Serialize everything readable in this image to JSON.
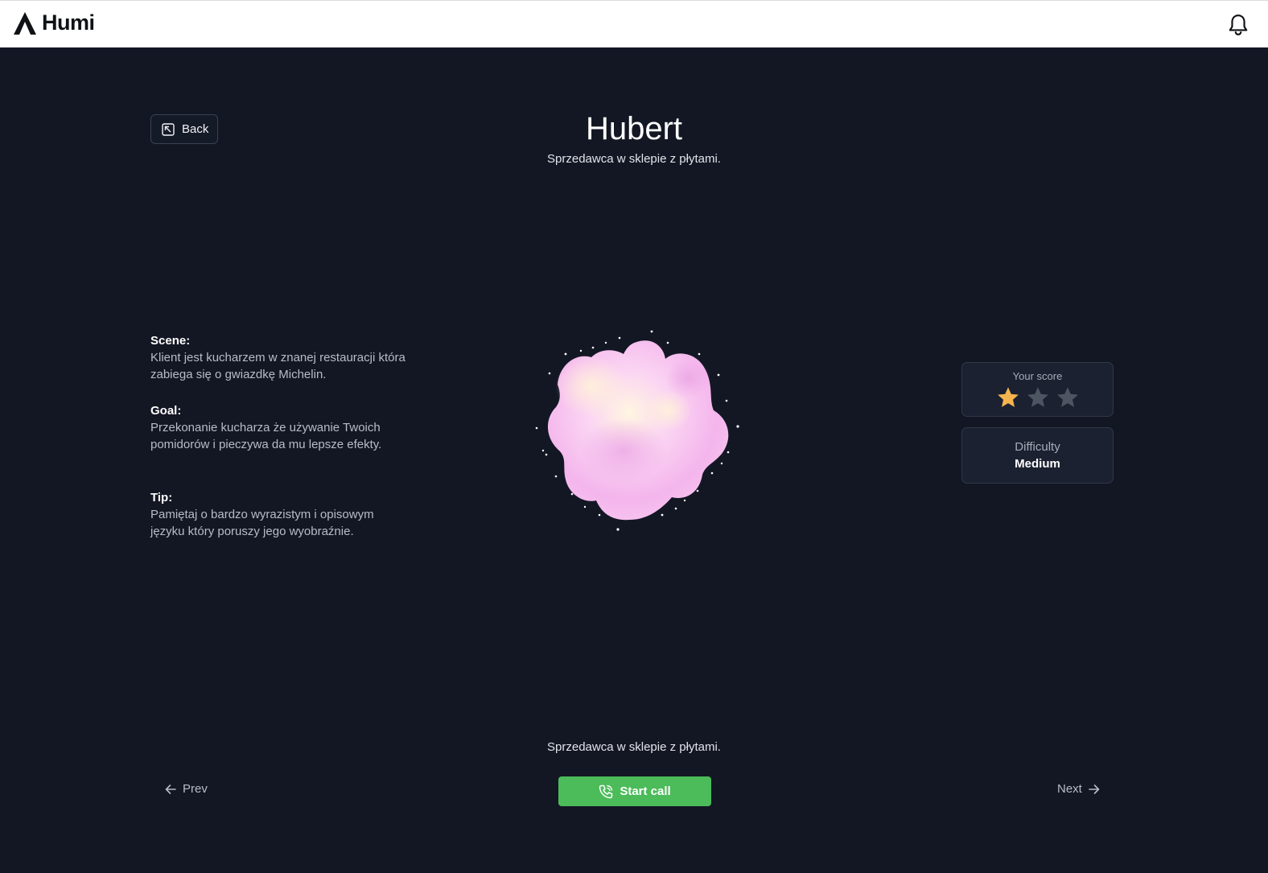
{
  "header": {
    "brand": "Humi",
    "icons": {
      "logo": "triangle-logo-icon",
      "notifications": "bell-icon"
    }
  },
  "persona": {
    "name": "Hubert",
    "role": "Sprzedawca w sklepie z płytami."
  },
  "back_button": {
    "label": "Back",
    "icon": "return-icon"
  },
  "briefing": {
    "scene_label": "Scene:",
    "scene_text": "Klient jest kucharzem w znanej restauracji która zabiega się o gwiazdkę Michelin.",
    "goal_label": "Goal:",
    "goal_text": "Przekonanie kucharza że używanie Twoich pomidorów i pieczywa da mu lepsze efekty.",
    "tip_label": "Tip:",
    "tip_text": "Pamiętaj o bardzo wyrazistym i opisowym języku który poruszy jego wyobraźnie."
  },
  "score": {
    "label": "Your score",
    "stars_filled": 1,
    "stars_total": 3,
    "filled_color": "#f6b44f",
    "empty_color": "#4d5563"
  },
  "difficulty": {
    "label": "Difficulty",
    "value": "Medium"
  },
  "footer": {
    "caption": "Sprzedawca w sklepie z płytami.",
    "start_label": "Start call",
    "start_color": "#4cbb5a",
    "prev_label": "Prev",
    "next_label": "Next"
  }
}
